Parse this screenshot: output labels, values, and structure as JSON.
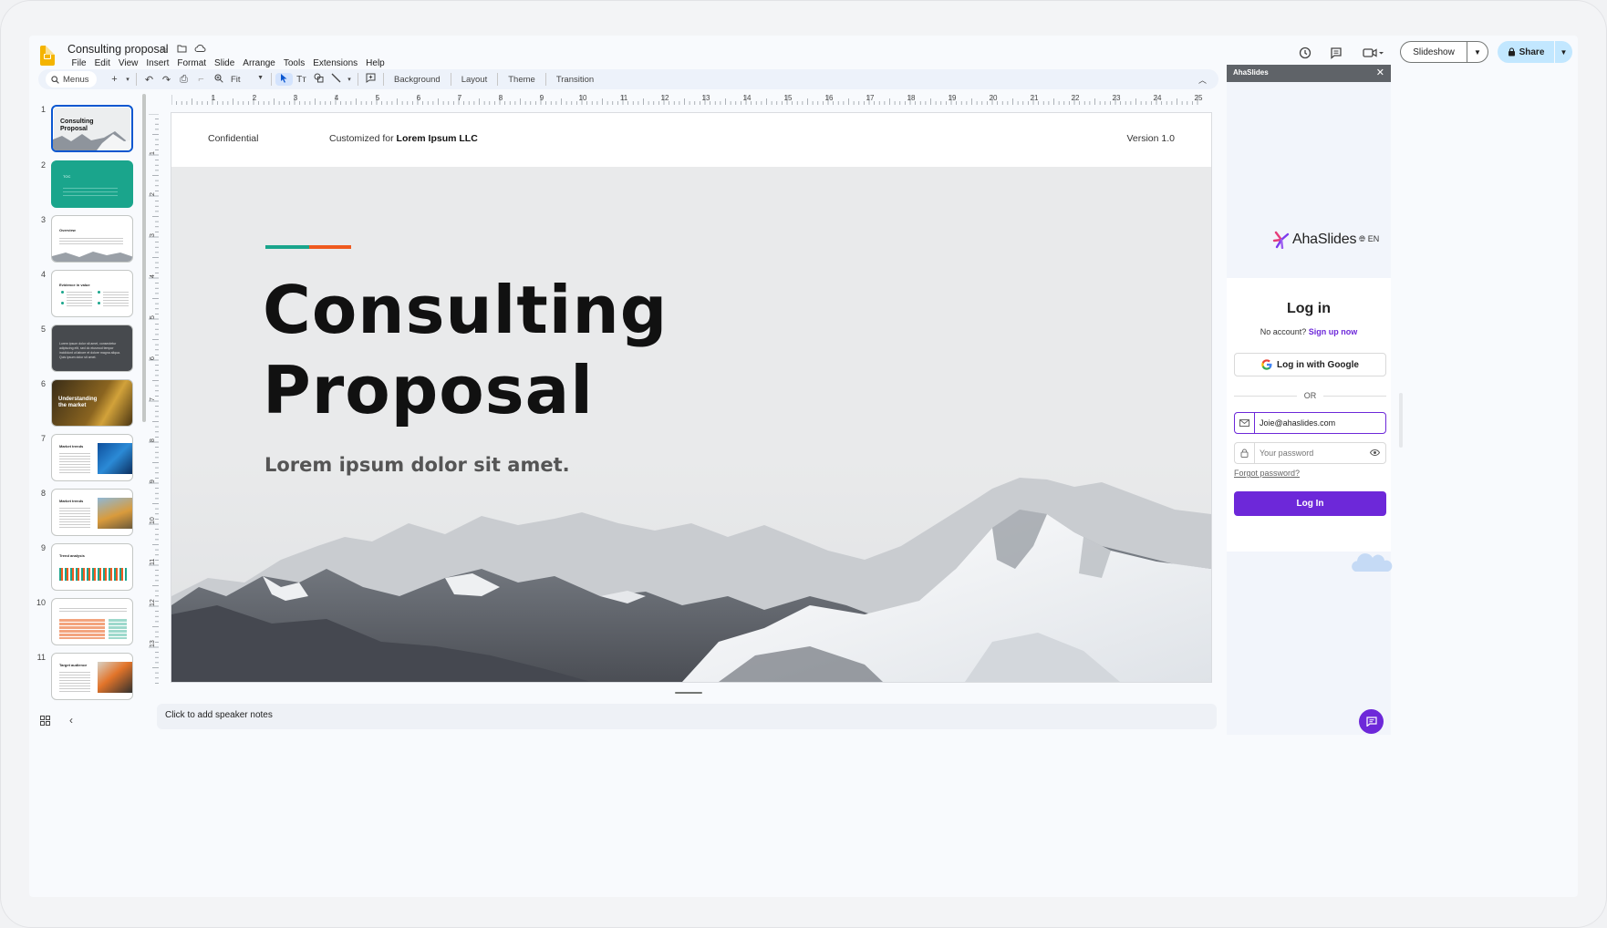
{
  "app": {
    "doc_title": "Consulting proposal",
    "menu": [
      "File",
      "Edit",
      "View",
      "Insert",
      "Format",
      "Slide",
      "Arrange",
      "Tools",
      "Extensions",
      "Help"
    ],
    "slideshow_label": "Slideshow",
    "share_label": "Share"
  },
  "toolbar": {
    "search_label": "Menus",
    "zoom_label": "Fit",
    "background_label": "Background",
    "layout_label": "Layout",
    "theme_label": "Theme",
    "transition_label": "Transition"
  },
  "filmstrip": {
    "slides": [
      {
        "num": "1",
        "title": "Consulting Proposal",
        "style": "mountain",
        "selected": true
      },
      {
        "num": "2",
        "title": "TOC",
        "style": "teal"
      },
      {
        "num": "3",
        "title": "Overview",
        "style": "mountain-light"
      },
      {
        "num": "4",
        "title": "Evidence in value",
        "style": "columns"
      },
      {
        "num": "5",
        "title": "Lorem ipsum dolor sit amet, consectetur adipiscing elit, sed do eiusmod tempor incididunt ut labore et dolore magna aliqua. Quis ipsum dolor sit amet.",
        "style": "dark"
      },
      {
        "num": "6",
        "title": "Understanding the market",
        "style": "gold"
      },
      {
        "num": "7",
        "title": "Market trends",
        "style": "photo-blue"
      },
      {
        "num": "8",
        "title": "Market trends",
        "style": "photo-orange"
      },
      {
        "num": "9",
        "title": "Trend analysis",
        "style": "bars"
      },
      {
        "num": "10",
        "title": "",
        "style": "table"
      },
      {
        "num": "11",
        "title": "Target audience",
        "style": "photo-people"
      }
    ]
  },
  "slide": {
    "confidential": "Confidential",
    "customized_prefix": "Customized for",
    "customized_client": "Lorem Ipsum LLC",
    "version": "Version 1.0",
    "title_line1": "Consulting",
    "title_line2": "Proposal",
    "subtitle": "Lorem ipsum dolor sit amet."
  },
  "speaker_notes_placeholder": "Click to add speaker notes",
  "panel": {
    "title": "AhaSlides",
    "brand": "AhaSlides",
    "lang": "EN",
    "login_title": "Log in",
    "no_account": "No account?",
    "signup": "Sign up now",
    "google_label": "Log in with Google",
    "or_label": "OR",
    "email_value": "Joie@ahaslides.com",
    "password_placeholder": "Your password",
    "forgot_label": "Forgot password?",
    "login_button": "Log In"
  },
  "colors": {
    "accent_teal": "#1aa58c",
    "accent_orange": "#ef5a1f",
    "aha_purple": "#6d28d9",
    "share_blue": "#c2e7ff"
  }
}
